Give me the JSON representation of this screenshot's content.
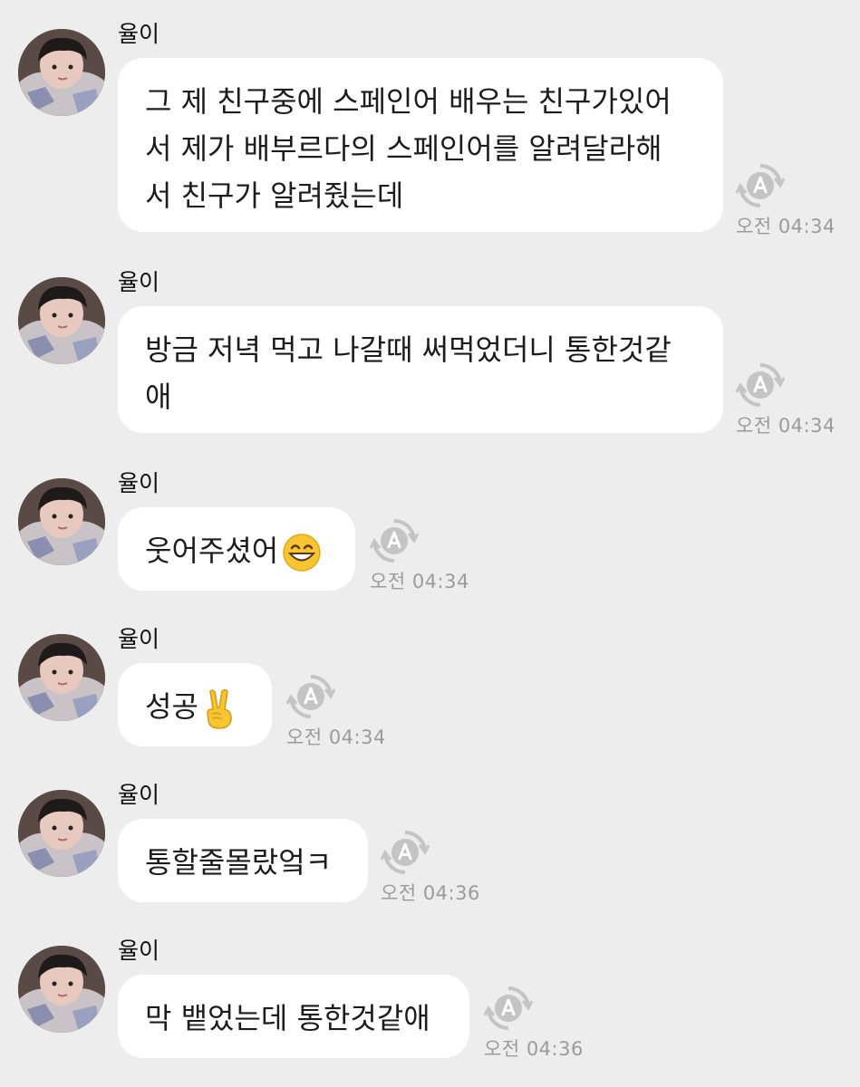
{
  "messages": [
    {
      "sender": "율이",
      "text": "그 제 친구중에 스페인어 배우는 친구가있어\n서 제가 배부르다의 스페인어를 알려달라해\n서 친구가 알려줬는데",
      "time": "오전 04:34"
    },
    {
      "sender": "율이",
      "text": "방금 저녁 먹고 나갈때 써먹었더니 통한것같\n애",
      "time": "오전 04:34"
    },
    {
      "sender": "율이",
      "text": "웃어주셨어",
      "emoji": "grinning-face-icon",
      "time": "오전 04:34"
    },
    {
      "sender": "율이",
      "text": "성공",
      "emoji": "victory-hand-icon",
      "time": "오전 04:34"
    },
    {
      "sender": "율이",
      "text": "통할줄몰랐엌ㅋ",
      "time": "오전 04:36"
    },
    {
      "sender": "율이",
      "text": "막 뱉었는데 통한것같애",
      "time": "오전 04:36"
    }
  ],
  "colors": {
    "background": "#ededed",
    "bubble": "#ffffff",
    "time": "#9b9b9b",
    "translate_icon": "#c4c4c4"
  },
  "icons": {
    "translate": "translate-a-icon"
  }
}
